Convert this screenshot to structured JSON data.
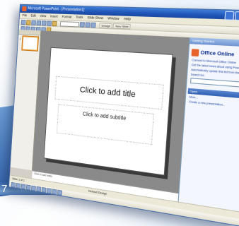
{
  "window": {
    "title": "Microsoft PowerPoint - [Presentation1]",
    "controls": [
      "minimize-icon",
      "maximize-icon",
      "close-icon"
    ]
  },
  "menubar": {
    "items": [
      "File",
      "Edit",
      "View",
      "Insert",
      "Format",
      "Tools",
      "Slide Show",
      "Window",
      "Help"
    ]
  },
  "toolbar": {
    "design_label": "Design",
    "new_slide_label": "New Slide"
  },
  "slide": {
    "title_placeholder": "Click to add title",
    "subtitle_placeholder": "Click to add subtitle"
  },
  "thumbnails": {
    "number": "1"
  },
  "notes": {
    "placeholder": "Click to add notes"
  },
  "task_pane": {
    "header": "Getting Started",
    "brand": "Office Online",
    "links": [
      "Connect to Microsoft Office Online",
      "Get the latest news about using PowerPoint",
      "Automatically update this list from the web"
    ],
    "search_label": "Search for:",
    "section_open": "Open",
    "open_links": [
      "More...",
      "Create a new presentation..."
    ]
  },
  "status": {
    "slide_info": "Slide 1 of 1",
    "design": "Default Design"
  },
  "desktop": {
    "corner_digit": "7"
  },
  "colors": {
    "titlebar": "#1f55b8",
    "task_pane_bg": "#f3f6fd",
    "thumbnail_highlight": "#f2a33a"
  }
}
